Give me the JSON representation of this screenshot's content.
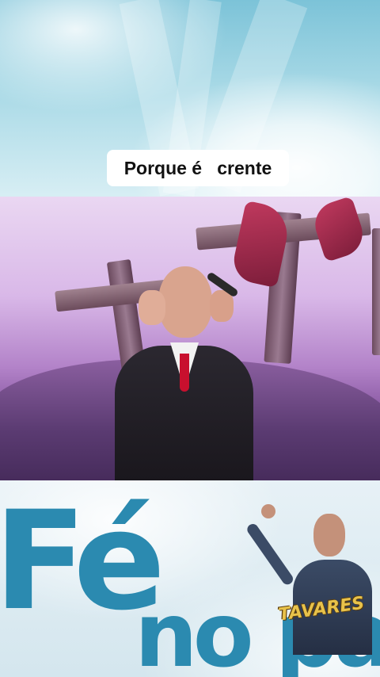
{
  "caption": {
    "text": "Porque é   crente"
  },
  "overlay_text": {
    "line1": "Fé",
    "line2": "no pai"
  },
  "brand_logo": {
    "text": "TAVARES"
  },
  "colors": {
    "overlay_blue": "#2b8ab0",
    "tie_red": "#c8102e",
    "brand_gold": "#e8c24a"
  }
}
